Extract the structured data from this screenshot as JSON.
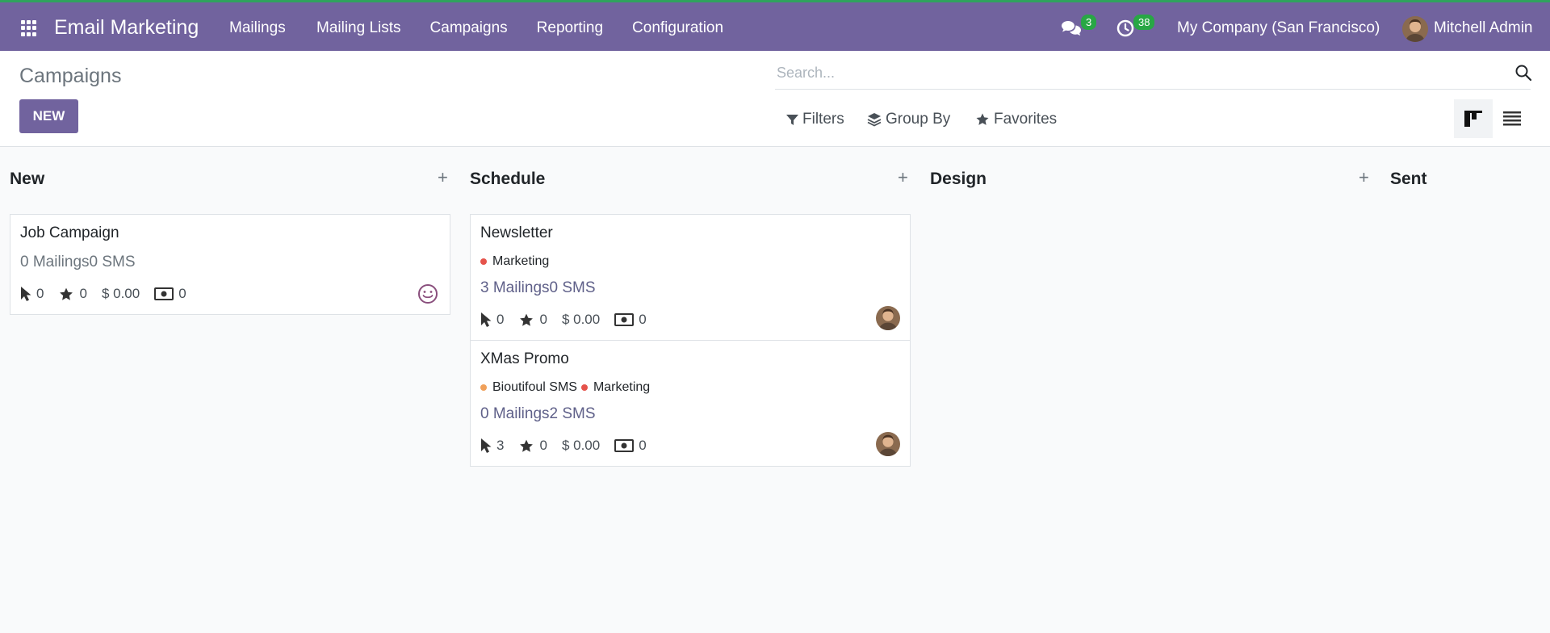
{
  "navbar": {
    "app_title": "Email Marketing",
    "menu": [
      "Mailings",
      "Mailing Lists",
      "Campaigns",
      "Reporting",
      "Configuration"
    ],
    "messages_count": "3",
    "activities_count": "38",
    "company": "My Company (San Francisco)",
    "user": "Mitchell Admin",
    "color": "#71639e"
  },
  "control": {
    "title": "Campaigns",
    "new_label": "NEW",
    "search_placeholder": "Search...",
    "filters_label": "Filters",
    "groupby_label": "Group By",
    "favorites_label": "Favorites"
  },
  "columns": [
    {
      "title": "New",
      "plus": "+"
    },
    {
      "title": "Schedule",
      "plus": "+"
    },
    {
      "title": "Design",
      "plus": "+"
    },
    {
      "title": "Sent"
    }
  ],
  "cards": [
    {
      "title": "Job Campaign",
      "counts": "0 Mailings0 SMS",
      "clicks": "0",
      "stars": "0",
      "revenue": "$ 0.00",
      "money": "0"
    },
    {
      "title": "Newsletter",
      "tags": [
        {
          "label": "Marketing",
          "color": "#e5534b"
        }
      ],
      "counts": "3 Mailings0 SMS",
      "clicks": "0",
      "stars": "0",
      "revenue": "$ 0.00",
      "money": "0"
    },
    {
      "title": "XMas Promo",
      "tags": [
        {
          "label": "Bioutifoul SMS",
          "color": "#f0a05a"
        },
        {
          "label": "Marketing",
          "color": "#e5534b"
        }
      ],
      "counts": "0 Mailings2 SMS",
      "clicks": "3",
      "stars": "0",
      "revenue": "$ 0.00",
      "money": "0"
    }
  ]
}
